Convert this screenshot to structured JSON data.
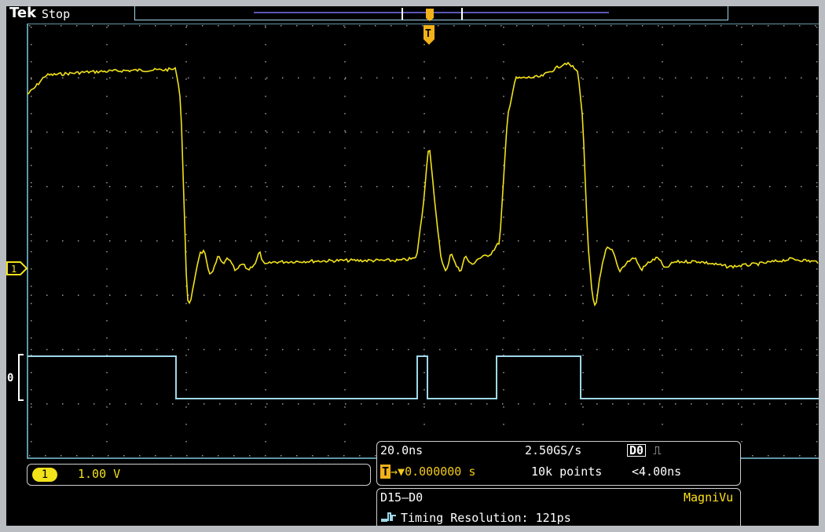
{
  "header": {
    "brand": "Tek",
    "run_state": "Stop"
  },
  "markers": {
    "ch1_ground": "1",
    "digital_ch": "0",
    "trigger_pos": "T"
  },
  "channel_readout": {
    "badge": "1",
    "scale": "1.00 V"
  },
  "horizontal_readout": {
    "time_div": "20.0ns",
    "sample_rate": "2.50GS/s",
    "trigger_badge": "T",
    "trigger_position": "→▼0.000000 s",
    "record_length": "10k points",
    "trigger_source": "D0",
    "trigger_type_symbol": "⎍",
    "trigger_condition": "<4.00ns"
  },
  "digital_readout": {
    "channels": "D15–D0",
    "mode": "MagniVu",
    "icon": "timing-resolution-icon",
    "timing_resolution": "Timing Resolution: 121ps"
  },
  "colors": {
    "ch1": "#f2e21a",
    "digital": "#9ed8e8",
    "trigger": "#f2b11a",
    "record_bar": "#5a55b8"
  }
}
